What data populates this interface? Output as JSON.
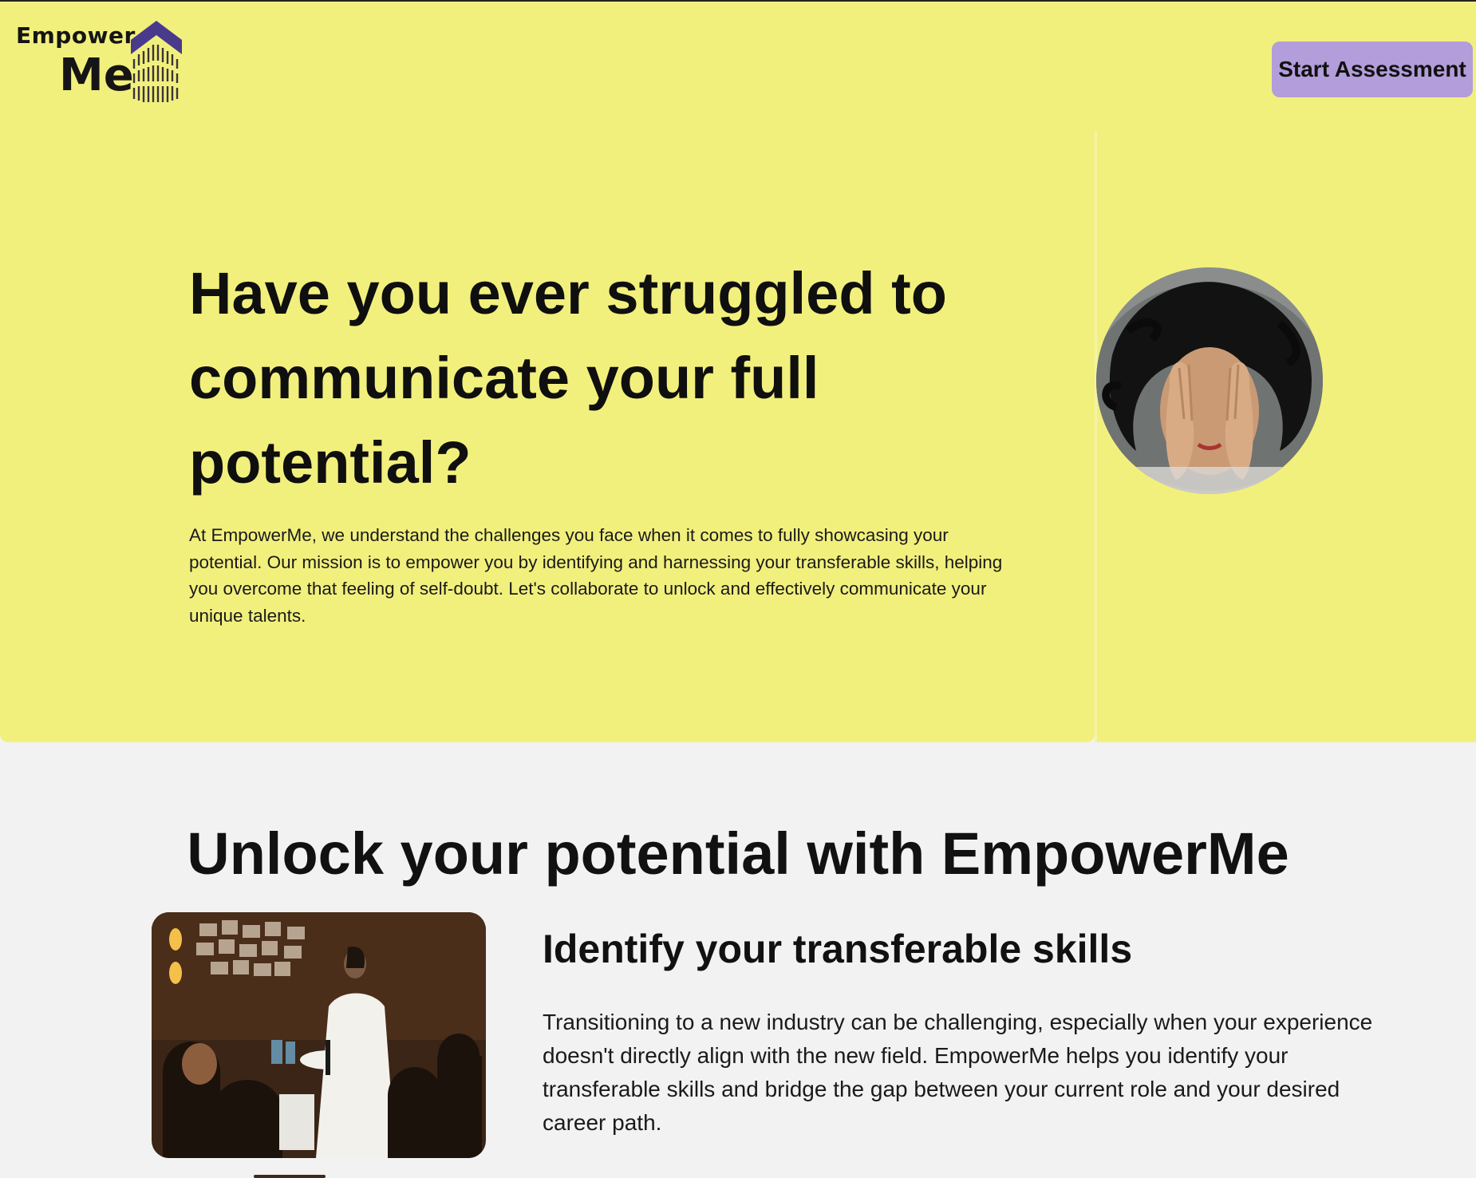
{
  "brand": {
    "logo_line1": "Empower",
    "logo_line2": "Me",
    "accent_purple": "#4a3a8c",
    "yellow": "#f2f07d"
  },
  "header": {
    "cta_label": "Start Assessment",
    "cta_color": "#b39ddb"
  },
  "hero": {
    "title": "Have you ever struggled to communicate your full potential?",
    "body": "At EmpowerMe, we understand the challenges you face when it comes to fully showcasing your potential. Our mission is to empower you by identifying and harnessing your transferable skills, helping you overcome that feeling of self-doubt. Let's collaborate to unlock and effectively communicate your unique talents.",
    "photo_icon": "woman-covering-face-photo"
  },
  "features": {
    "section_title": "Unlock your potential with EmpowerMe",
    "items": [
      {
        "title": "Identify your transferable skills",
        "body": "Transitioning to a new industry can be challenging, especially when your experience doesn't directly align with the new field. EmpowerMe helps you identify your transferable skills and bridge the gap between your current role and your desired career path.",
        "photo_icon": "woman-speaking-to-group-photo"
      }
    ]
  }
}
